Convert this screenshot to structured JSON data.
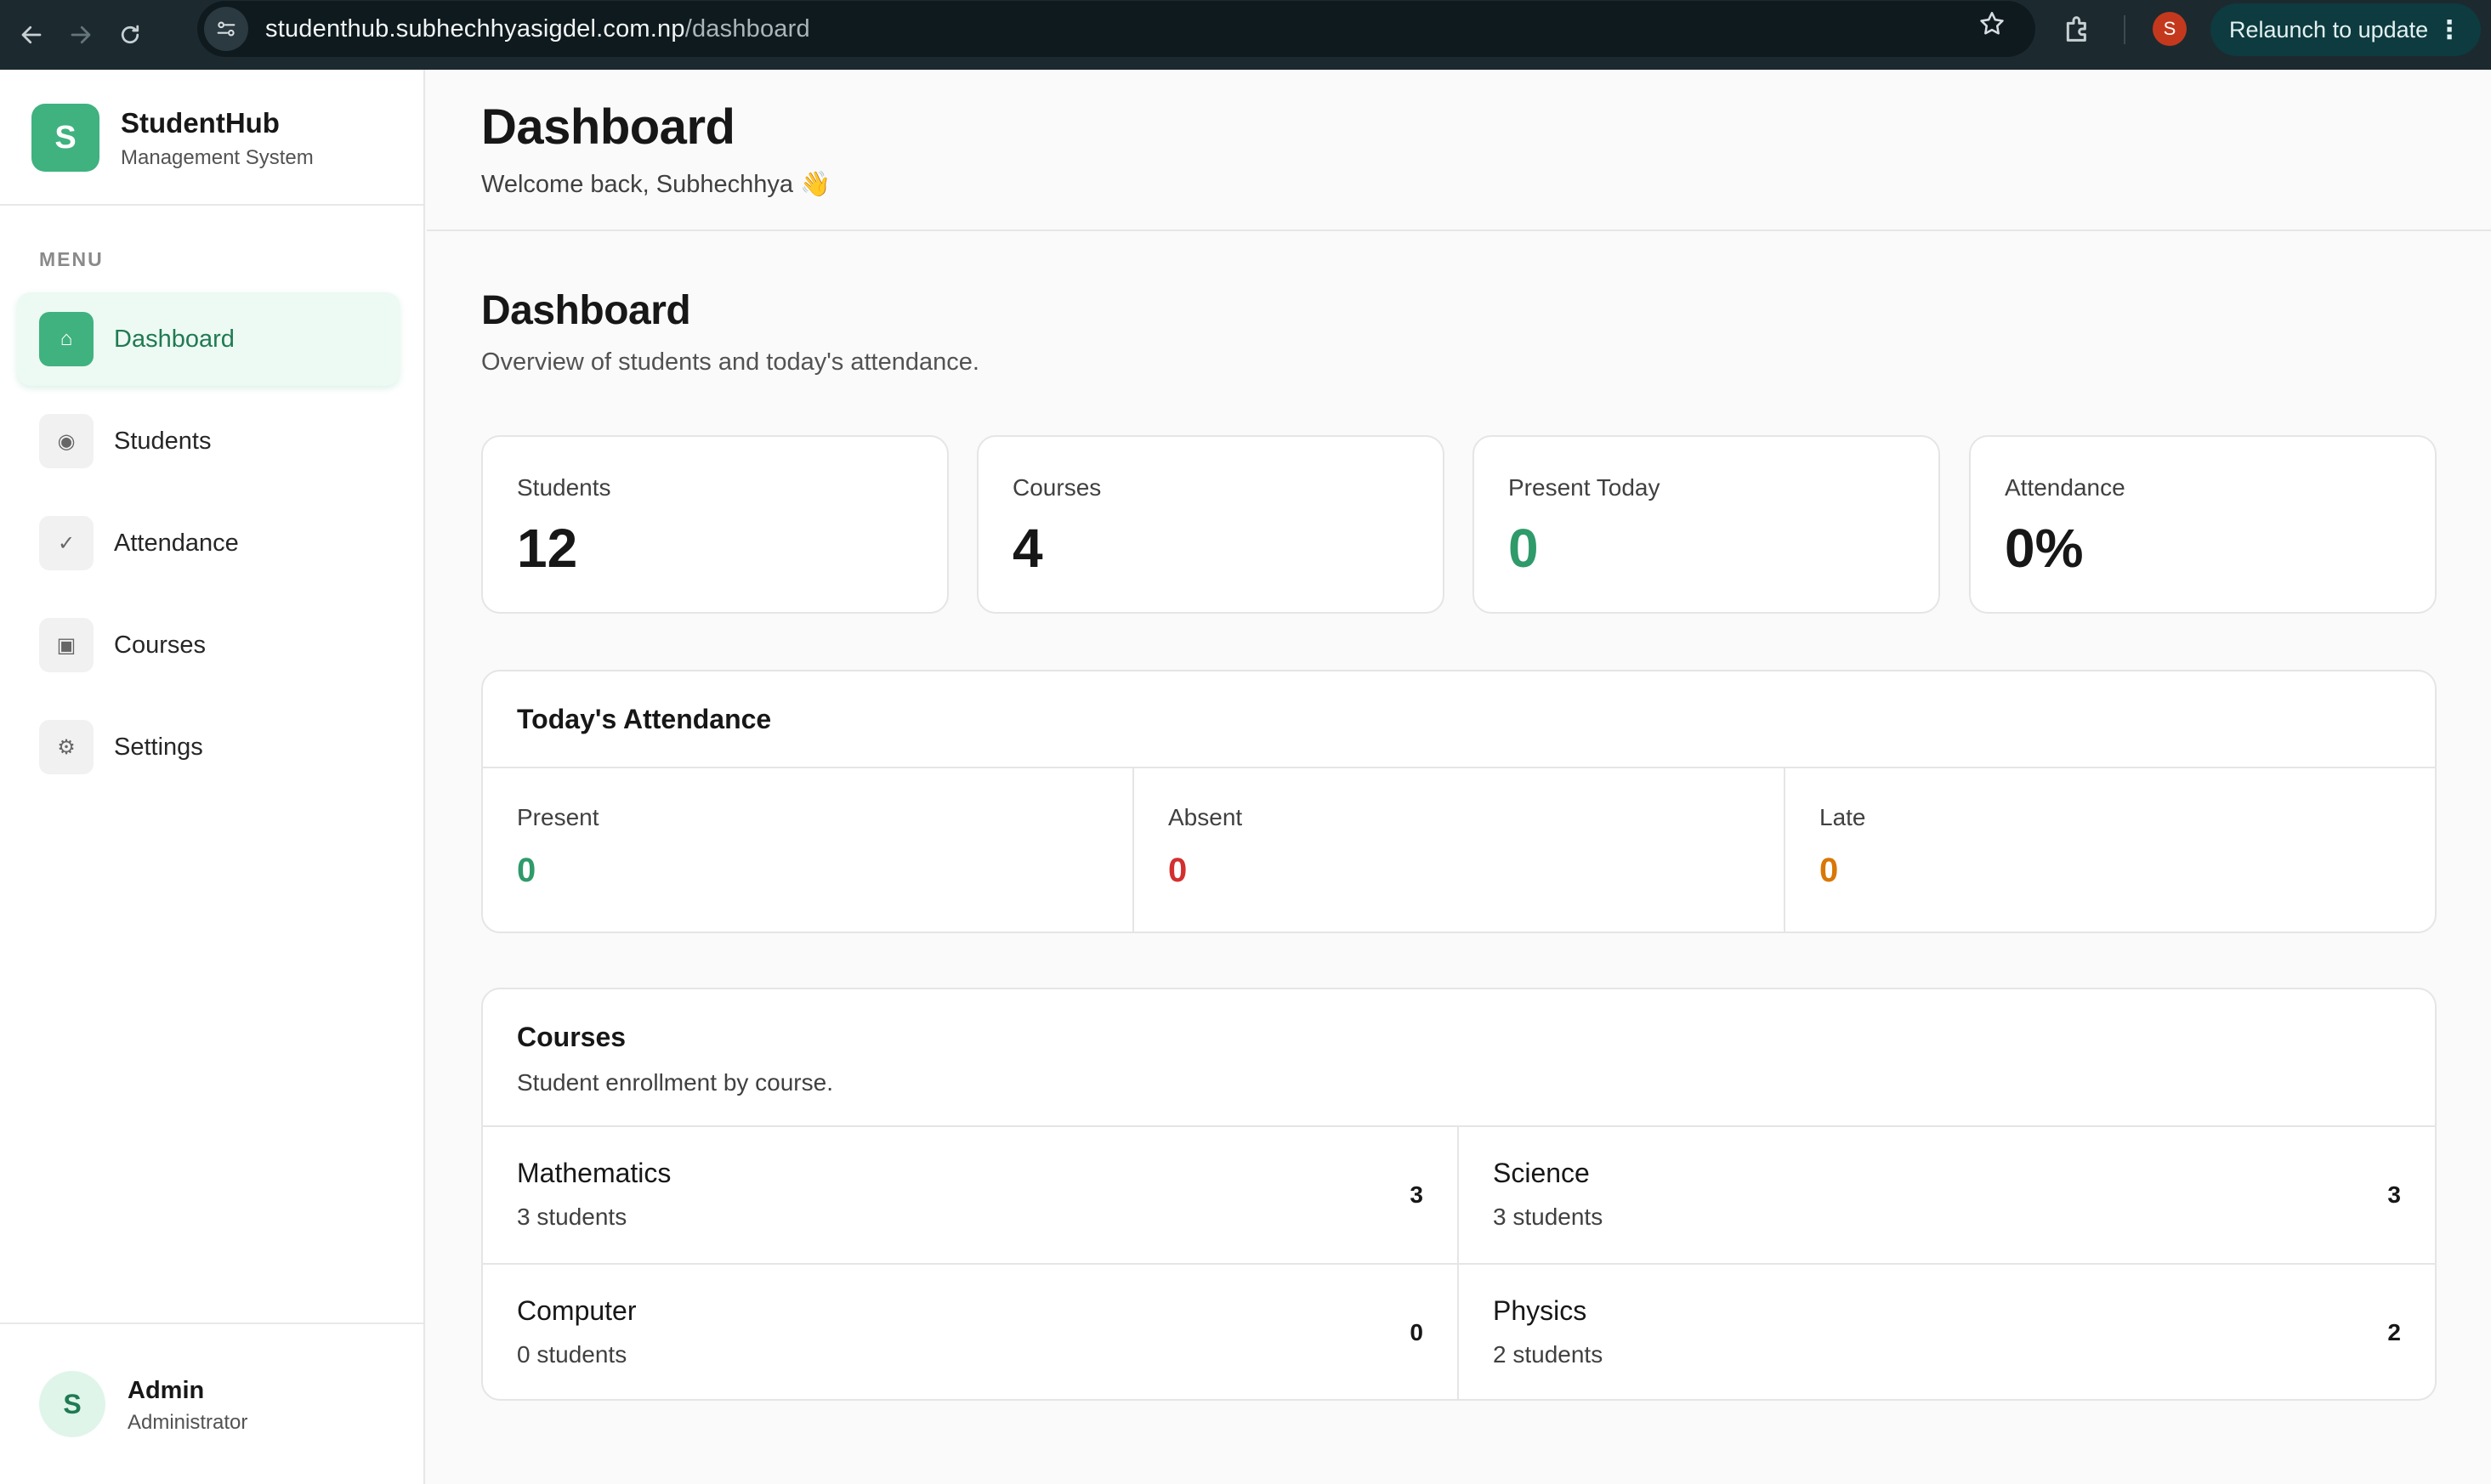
{
  "browser": {
    "url_host": "studenthub.subhechhyasigdel.com.np",
    "url_path": "/dashboard",
    "profile_initial": "S",
    "relaunch_label": "Relaunch to update"
  },
  "sidebar": {
    "brand_initial": "S",
    "brand_name": "StudentHub",
    "brand_sub": "Management System",
    "menu_heading": "MENU",
    "items": [
      {
        "label": "Dashboard",
        "icon": "⌂"
      },
      {
        "label": "Students",
        "icon": "◉"
      },
      {
        "label": "Attendance",
        "icon": "✓"
      },
      {
        "label": "Courses",
        "icon": "▣"
      },
      {
        "label": "Settings",
        "icon": "⚙"
      }
    ],
    "user": {
      "initial": "S",
      "name": "Admin",
      "role": "Administrator"
    }
  },
  "header": {
    "title": "Dashboard",
    "welcome": "Welcome back, Subhechhya 👋"
  },
  "main": {
    "title": "Dashboard",
    "subtitle": "Overview of students and today's attendance.",
    "stats": [
      {
        "label": "Students",
        "value": "12"
      },
      {
        "label": "Courses",
        "value": "4"
      },
      {
        "label": "Present Today",
        "value": "0"
      },
      {
        "label": "Attendance",
        "value": "0%"
      }
    ],
    "attendance": {
      "title": "Today's Attendance",
      "present_label": "Present",
      "present_value": "0",
      "absent_label": "Absent",
      "absent_value": "0",
      "late_label": "Late",
      "late_value": "0"
    },
    "courses": {
      "title": "Courses",
      "subtitle": "Student enrollment by course.",
      "items": [
        {
          "name": "Mathematics",
          "students_text": "3 students",
          "count": "3"
        },
        {
          "name": "Science",
          "students_text": "3 students",
          "count": "3"
        },
        {
          "name": "Computer",
          "students_text": "0 students",
          "count": "0"
        },
        {
          "name": "Physics",
          "students_text": "2 students",
          "count": "2"
        }
      ]
    }
  },
  "colors": {
    "accent": "#3fb27f",
    "present": "#2f9a6a",
    "absent": "#d32f2f",
    "late": "#d97706"
  }
}
